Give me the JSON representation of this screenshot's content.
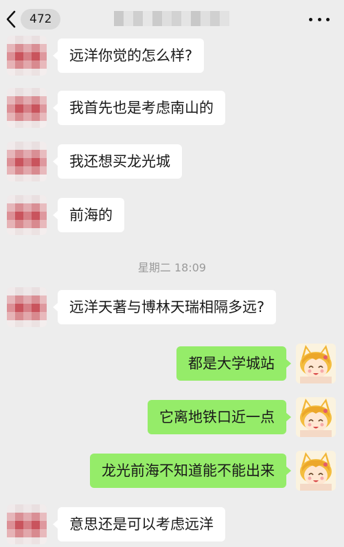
{
  "header": {
    "unread_count": "472",
    "icons": {
      "back": "chevron-left-icon",
      "more": "more-dots-icon"
    }
  },
  "colors": {
    "background": "#ededed",
    "incoming_bubble": "#ffffff",
    "outgoing_bubble": "#95ec69",
    "timestamp_text": "#9a9a9a"
  },
  "messages": [
    {
      "side": "left",
      "text": "远洋你觉的怎么样?"
    },
    {
      "side": "left",
      "text": "我首先也是考虑南山的"
    },
    {
      "side": "left",
      "text": "我还想买龙光城"
    },
    {
      "side": "left",
      "text": "前海的"
    },
    {
      "side": "left",
      "text": "远洋天著与博林天瑞相隔多远?"
    },
    {
      "side": "right",
      "text": "都是大学城站"
    },
    {
      "side": "right",
      "text": "它离地铁口近一点"
    },
    {
      "side": "right",
      "text": "龙光前海不知道能不能出来"
    },
    {
      "side": "left",
      "text": "意思还是可以考虑远洋"
    }
  ],
  "timestamp": "星期二 18:09"
}
